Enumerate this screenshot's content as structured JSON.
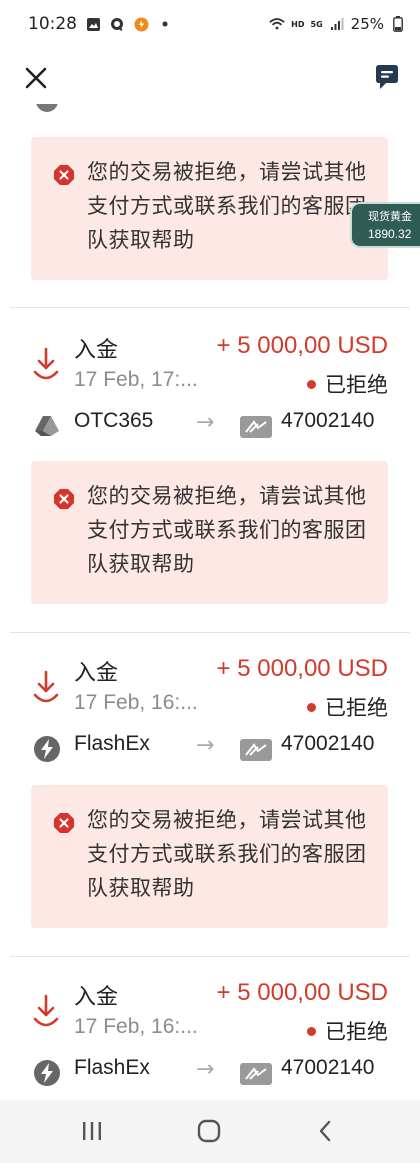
{
  "status_bar": {
    "time": "10:28",
    "network": "HD",
    "signal": "5G",
    "battery": "25%"
  },
  "ticker": {
    "label": "现货黄金",
    "price": "1890.32"
  },
  "notice_text": "您的交易被拒绝，请尝试其他支付方式或联系我们的客服团队获取帮助",
  "transactions": [
    {
      "type": "入金",
      "amount": "+ 5 000,00 USD",
      "date": "17 Feb, 17:...",
      "status": "已拒绝",
      "provider": "OTC365",
      "provider_icon": "otc365-icon",
      "account": "47002140"
    },
    {
      "type": "入金",
      "amount": "+ 5 000,00 USD",
      "date": "17 Feb, 16:...",
      "status": "已拒绝",
      "provider": "FlashEx",
      "provider_icon": "flashex-icon",
      "account": "47002140"
    },
    {
      "type": "入金",
      "amount": "+ 5 000,00 USD",
      "date": "17 Feb, 16:...",
      "status": "已拒绝",
      "provider": "FlashEx",
      "provider_icon": "flashex-icon",
      "account": "47002140"
    }
  ],
  "colors": {
    "accent_red": "#d13b2b",
    "notice_bg": "#fde8e6",
    "ticker_bg": "#2f5d55"
  }
}
